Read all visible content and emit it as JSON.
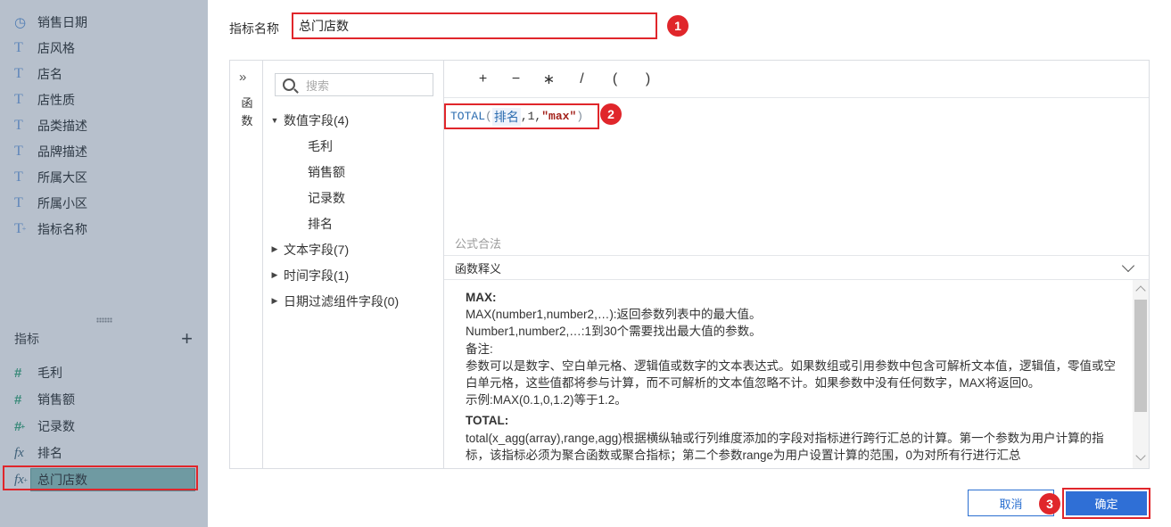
{
  "sidebar": {
    "dimensions": [
      {
        "label": "销售日期",
        "icon": "clock-icon",
        "glyph": "◷"
      },
      {
        "label": "店风格",
        "icon": "text-field-icon",
        "glyph": "T"
      },
      {
        "label": "店名",
        "icon": "text-field-icon",
        "glyph": "T"
      },
      {
        "label": "店性质",
        "icon": "text-field-icon",
        "glyph": "T"
      },
      {
        "label": "品类描述",
        "icon": "text-field-icon",
        "glyph": "T"
      },
      {
        "label": "品牌描述",
        "icon": "text-field-icon",
        "glyph": "T"
      },
      {
        "label": "所属大区",
        "icon": "text-field-icon",
        "glyph": "T"
      },
      {
        "label": "所属小区",
        "icon": "text-field-icon",
        "glyph": "T"
      },
      {
        "label": "指标名称",
        "icon": "calculated-text-field-icon",
        "glyph": "T"
      }
    ],
    "metrics_title": "指标",
    "add_icon": "plus-icon",
    "metrics": [
      {
        "label": "毛利",
        "icon": "number-field-icon",
        "glyph": "#"
      },
      {
        "label": "销售额",
        "icon": "number-field-icon",
        "glyph": "#"
      },
      {
        "label": "记录数",
        "icon": "calculated-number-field-icon",
        "glyph": "#"
      },
      {
        "label": "排名",
        "icon": "formula-icon",
        "glyph": "fx"
      },
      {
        "label": "总门店数",
        "icon": "calculated-formula-icon",
        "glyph": "fx"
      }
    ]
  },
  "dialog": {
    "name_label": "指标名称",
    "name_value": "总门店数",
    "badges": [
      "1",
      "2",
      "3"
    ],
    "func_label": "函数",
    "search_placeholder": "搜索",
    "tree": {
      "numeric": "数值字段(4)",
      "numeric_children": [
        "毛利",
        "销售额",
        "记录数",
        "排名"
      ],
      "text": "文本字段(7)",
      "time": "时间字段(1)",
      "date_filter": "日期过滤组件字段(0)"
    },
    "operators": [
      "+",
      "−",
      "∗",
      "/",
      "(",
      ")"
    ],
    "formula": {
      "fn": "TOTAL",
      "open": "(",
      "field": "排名",
      "sep1": ",1,",
      "str": "\"max\"",
      "close": ")"
    },
    "valid_text": "公式合法",
    "desc_header": "函数释义",
    "desc_lines": [
      {
        "text": "MAX:",
        "bold": true
      },
      {
        "text": "MAX(number1,number2,…):返回参数列表中的最大值。",
        "bold": false
      },
      {
        "text": "Number1,number2,…:1到30个需要找出最大值的参数。",
        "bold": false
      },
      {
        "text": "备注:",
        "bold": false
      },
      {
        "text": "参数可以是数字、空白单元格、逻辑值或数字的文本表达式。如果数组或引用参数中包含可解析文本值，逻辑值，零值或空白单元格，这些值都将参与计算，而不可解析的文本值忽略不计。如果参数中没有任何数字，MAX将返回0。",
        "bold": false
      },
      {
        "text": "示例:MAX(0.1,0,1.2)等于1.2。",
        "bold": false
      },
      {
        "text": "TOTAL:",
        "bold": true
      },
      {
        "text": "total(x_agg(array),range,agg)根据横纵轴或行列维度添加的字段对指标进行跨行汇总的计算。第一个参数为用户计算的指标，该指标必须为聚合函数或聚合指标；第二个参数range为用户设置计算的范围，0为对所有行进行汇总",
        "bold": false
      }
    ],
    "cancel_label": "取消",
    "ok_label": "确定"
  },
  "colors": {
    "sidebar_bg": "#b7c0cc",
    "highlight_red": "#e0262b",
    "primary_blue": "#2f6fd6"
  }
}
